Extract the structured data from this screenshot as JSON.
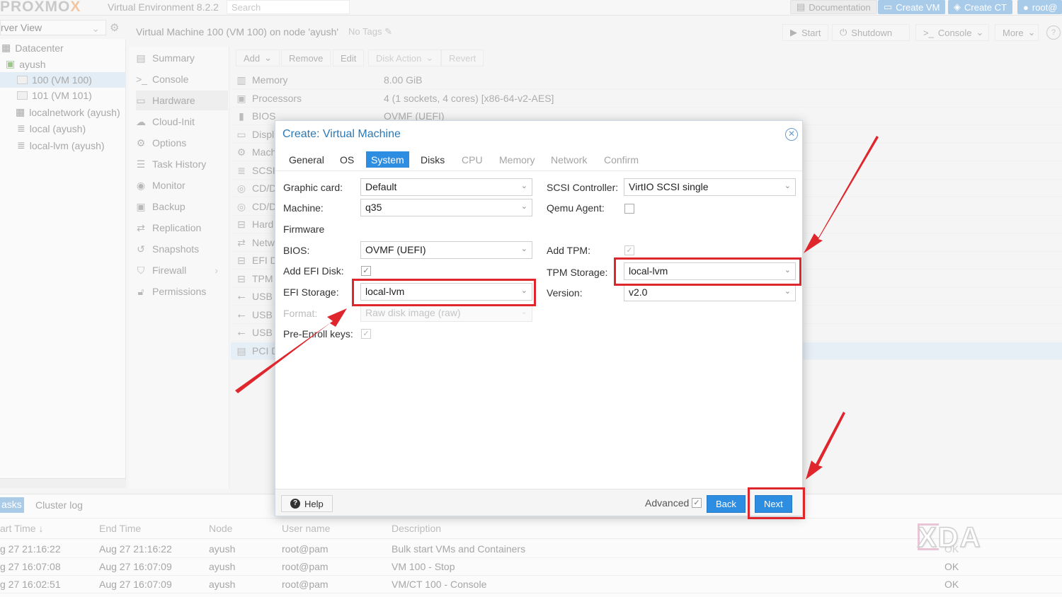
{
  "topbar": {
    "logo_main": "PROXMO",
    "logo_x": "X",
    "product": "Virtual Environment 8.2.2",
    "search_placeholder": "Search",
    "documentation": "Documentation",
    "create_vm": "Create VM",
    "create_ct": "Create CT",
    "user": "root@"
  },
  "tree": {
    "view_label": "rver View",
    "nodes": [
      {
        "label": "Datacenter"
      },
      {
        "label": "ayush"
      },
      {
        "label": "100 (VM 100)"
      },
      {
        "label": "101 (VM 101)"
      },
      {
        "label": "localnetwork (ayush)"
      },
      {
        "label": "local (ayush)"
      },
      {
        "label": "local-lvm (ayush)"
      }
    ]
  },
  "header": {
    "title": "Virtual Machine 100 (VM 100) on node 'ayush'",
    "no_tags": "No Tags",
    "start": "Start",
    "shutdown": "Shutdown",
    "console": "Console",
    "more": "More"
  },
  "subnav": {
    "items": [
      {
        "label": "Summary"
      },
      {
        "label": "Console"
      },
      {
        "label": "Hardware"
      },
      {
        "label": "Cloud-Init"
      },
      {
        "label": "Options"
      },
      {
        "label": "Task History"
      },
      {
        "label": "Monitor"
      },
      {
        "label": "Backup"
      },
      {
        "label": "Replication"
      },
      {
        "label": "Snapshots"
      },
      {
        "label": "Firewall"
      },
      {
        "label": "Permissions"
      }
    ]
  },
  "hwtoolbar": {
    "add": "Add",
    "remove": "Remove",
    "edit": "Edit",
    "disk_action": "Disk Action",
    "revert": "Revert"
  },
  "hardware": [
    {
      "name": "Memory",
      "value": "8.00 GiB"
    },
    {
      "name": "Processors",
      "value": "4 (1 sockets, 4 cores) [x86-64-v2-AES]"
    },
    {
      "name": "BIOS",
      "value": "OVMF (UEFI)"
    },
    {
      "name": "Displ",
      "value": ""
    },
    {
      "name": "Mach",
      "value": ""
    },
    {
      "name": "SCSI",
      "value": ""
    },
    {
      "name": "CD/D",
      "value": ""
    },
    {
      "name": "CD/D",
      "value": ""
    },
    {
      "name": "Hard",
      "value": ""
    },
    {
      "name": "Netw",
      "value": ""
    },
    {
      "name": "EFI D",
      "value": ""
    },
    {
      "name": "TPM",
      "value": ""
    },
    {
      "name": "USB",
      "value": ""
    },
    {
      "name": "USB",
      "value": ""
    },
    {
      "name": "USB",
      "value": ""
    },
    {
      "name": "PCI D",
      "value": ""
    }
  ],
  "tasks": {
    "tab_tasks": "asks",
    "tab_cluster": "Cluster log",
    "columns": [
      "art Time",
      "End Time",
      "Node",
      "User name",
      "Description",
      ""
    ],
    "rows": [
      {
        "start": "g 27 21:16:22",
        "end": "Aug 27 21:16:22",
        "node": "ayush",
        "user": "root@pam",
        "desc": "Bulk start VMs and Containers",
        "status": "OK"
      },
      {
        "start": "g 27 16:07:08",
        "end": "Aug 27 16:07:09",
        "node": "ayush",
        "user": "root@pam",
        "desc": "VM 100 - Stop",
        "status": "OK"
      },
      {
        "start": "g 27 16:02:51",
        "end": "Aug 27 16:07:09",
        "node": "ayush",
        "user": "root@pam",
        "desc": "VM/CT 100 - Console",
        "status": "OK"
      }
    ]
  },
  "dialog": {
    "title": "Create: Virtual Machine",
    "tabs": [
      "General",
      "OS",
      "System",
      "Disks",
      "CPU",
      "Memory",
      "Network",
      "Confirm"
    ],
    "graphic_card_label": "Graphic card:",
    "graphic_card_value": "Default",
    "machine_label": "Machine:",
    "machine_value": "q35",
    "firmware_label": "Firmware",
    "bios_label": "BIOS:",
    "bios_value": "OVMF (UEFI)",
    "add_efi_label": "Add EFI Disk:",
    "efi_storage_label": "EFI Storage:",
    "efi_storage_value": "local-lvm",
    "format_label": "Format:",
    "format_value": "Raw disk image (raw)",
    "pre_enroll_label": "Pre-Enroll keys:",
    "scsi_label": "SCSI Controller:",
    "scsi_value": "VirtIO SCSI single",
    "qemu_label": "Qemu Agent:",
    "add_tpm_label": "Add TPM:",
    "tpm_storage_label": "TPM Storage:",
    "tpm_storage_value": "local-lvm",
    "version_label": "Version:",
    "version_value": "v2.0",
    "help": "Help",
    "advanced": "Advanced",
    "back": "Back",
    "next": "Next"
  },
  "watermark": {
    "text": "XDA"
  },
  "colors": {
    "accent": "#2d8de0",
    "highlight": "#e0262d"
  },
  "icons": [
    "search-icon",
    "gear-icon",
    "close-icon",
    "chevron-down-icon",
    "help-icon",
    "pencil-icon",
    "check-icon"
  ]
}
